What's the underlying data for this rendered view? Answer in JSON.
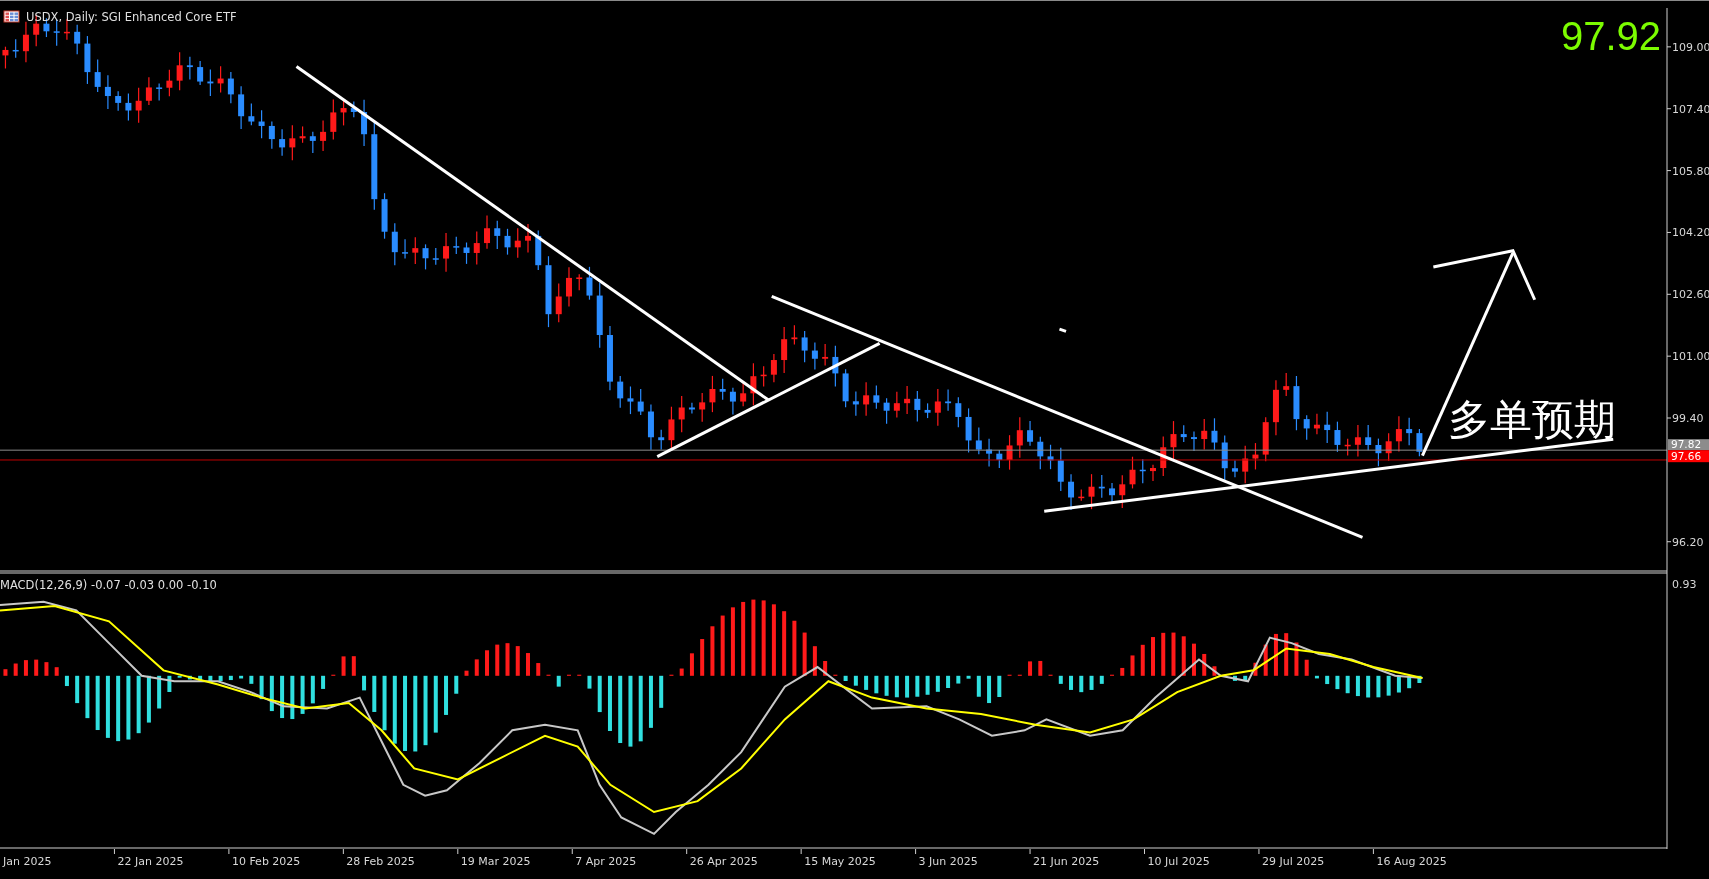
{
  "chart": {
    "title": "USDX, Daily: SGI Enhanced Core ETF",
    "last_price": "97.92",
    "annotation": "多单预期",
    "price_axis": {
      "ticks": [
        "109.00",
        "107.40",
        "105.80",
        "104.20",
        "102.60",
        "101.00",
        "99.40"
      ],
      "bottom_tick": "96.20",
      "current_label": "97.82",
      "line_label": "97.66"
    }
  },
  "indicator": {
    "label": "MACD(12,26,9) -0.07 -0.03 0.00 -0.10",
    "axis_tick": "0.93"
  },
  "time_axis": {
    "labels": [
      "Jan 2025",
      "22 Jan 2025",
      "10 Feb 2025",
      "28 Feb 2025",
      "19 Mar 2025",
      "7 Apr 2025",
      "26 Apr 2025",
      "15 May 2025",
      "3 Jun 2025",
      "21 Jun 2025",
      "10 Jul 2025",
      "29 Jul 2025",
      "16 Aug 2025"
    ]
  }
}
